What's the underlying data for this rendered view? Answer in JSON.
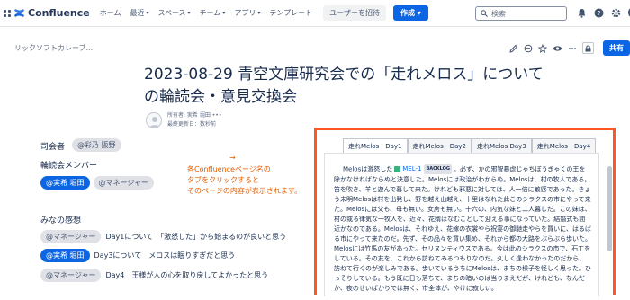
{
  "nav": {
    "logo_text": "Confluence",
    "items": [
      {
        "label": "ホーム",
        "dropdown": false
      },
      {
        "label": "最近",
        "dropdown": true
      },
      {
        "label": "スペース",
        "dropdown": true
      },
      {
        "label": "チーム",
        "dropdown": true
      },
      {
        "label": "アプリ",
        "dropdown": true
      },
      {
        "label": "テンプレート",
        "dropdown": false
      }
    ],
    "invite_label": "ユーザーを招待",
    "create_label": "作成",
    "search_placeholder": "検索"
  },
  "toolbar": {
    "breadcrumb": "リックソフトカレーブ...",
    "share_label": "共有"
  },
  "page": {
    "title": "2023-08-29 青空文庫研究会での「走れメロス」についての輪読会・意見交換会",
    "owner_label": "所有者: 実希 堀田",
    "owner_more": "•••",
    "updated_label": "最終更新日：数秒前"
  },
  "body": {
    "moderator_label": "司会者",
    "moderator": "@彩乃 阪野",
    "members_label": "輪読会メンバー",
    "members": [
      "@実希 堀田",
      "@マネージャー"
    ],
    "impressions_label": "みなの感想",
    "impressions": [
      {
        "mention": "@マネージャー",
        "self": false,
        "text": "Day1について　「激怒した」から始まるのが良いと思う"
      },
      {
        "mention": "@実希 堀田",
        "self": true,
        "text": "Day3について　メロスは眠りすぎだと思う"
      },
      {
        "mention": "@マネージャー",
        "self": false,
        "text": "Day4　王様が人の心を取り戻してよかったと思う"
      }
    ]
  },
  "annotation": {
    "arrow": "→",
    "lines": [
      "各Confluenceページ名の",
      "タブをクリックすると",
      "そのページの内容が表示されます。"
    ]
  },
  "tabs_panel": {
    "tabs": [
      "走れMelos　Day1",
      "走れMelos　Day2",
      "走れMelos Day3",
      "走れMelos　Day4"
    ],
    "active_index": 0,
    "text_before": "Melosは激怒した",
    "jira_key": "MEL-1",
    "jira_status": "BACKLOG",
    "text_after": "。必ず、かの邪智暴虐じゃちぼうぎゃくの王を除かなければならぬと決意した。Melosには政治がわからぬ。Melosは、村の牧人である。笛を吹き、羊と遊んで暮して来た。けれども邪悪に対しては、人一倍に敏感であった。きょう未明Melosは村を出発し、野を越え山越え、十里はなれた此このシラクスの市にやって来た。Melosには父も、母も無い。女房も無い。十六の、内気な妹と二人暮しだ。この妹は、村の或る律気な一牧人を、近々、花婿はなむことして迎える事になっていた。結婚式も間近かなのである。Melosは、それゆえ、花嫁の衣裳やら祝宴の御馳走やらを買いに、はるばる市にやって来たのだ。先ず、その品々を買い集め、それから都の大路をぶらぶら歩いた。Melosには竹馬の友があった。セリヌンティウスである。今は此のシラクスの市で、石工をしている。その友を、これから訪ねてみるつもりなのだ。久しく逢わなかったのだから、訪ねて行くのが楽しみである。歩いているうちにMelosは、まちの様子を怪しく思った。ひっそりしている。もう既に日も落ちて、まちの暗いのは当りまえだが、けれども、なんだか、夜のせいばかりでは無く、市全体が、やけに寂しい。"
  },
  "colors": {
    "brand": "#0c66e4",
    "highlight": "#ff5722",
    "annotation": "#e65c00"
  },
  "icons": [
    "grid-icon",
    "confluence-logo-icon",
    "search-icon",
    "bell-icon",
    "help-icon",
    "settings-icon",
    "edit-icon",
    "comment-icon",
    "star-icon",
    "watch-icon",
    "restrict-icon",
    "more-icon",
    "jira-icon"
  ]
}
